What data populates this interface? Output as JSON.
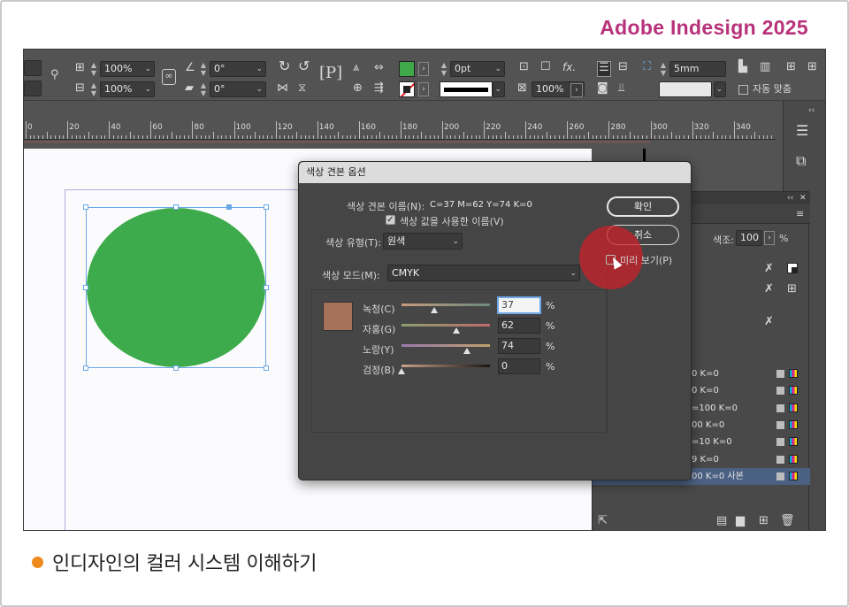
{
  "brand": "Adobe Indesign 2025",
  "caption": "인디자인의 컬러 시스템 이해하기",
  "colors": {
    "brand": "#b8327a",
    "bullet": "#ef8a1e",
    "fill_swatch": "#3fa94a",
    "preview_swatch": "#a7725a",
    "highlight": "#ce1e28"
  },
  "control_bar": {
    "scale_x": "100%",
    "scale_y": "100%",
    "rotate": "0°",
    "shear": "0°",
    "stroke_weight": "0pt",
    "opacity": "100%",
    "gap": "5mm",
    "auto_fit_label": "자동 맞춤",
    "paragraph_glyph": "P",
    "fx_label": "fx."
  },
  "ruler": {
    "ticks": [
      "0",
      "20",
      "40",
      "60",
      "80",
      "100",
      "120",
      "140",
      "160",
      "180",
      "200",
      "220",
      "240",
      "260",
      "280",
      "300",
      "320",
      "340"
    ]
  },
  "swatches_panel": {
    "tint_label": "색조:",
    "tint_value": "100",
    "tint_unit": "%",
    "rows": [
      {
        "label": "0 K=0",
        "selected": false
      },
      {
        "label": "0 K=0",
        "selected": false
      },
      {
        "label": "=100 K=0",
        "selected": false
      },
      {
        "label": "00 K=0",
        "selected": false
      },
      {
        "label": "=10 K=0",
        "selected": false
      },
      {
        "label": "9 K=0",
        "selected": false
      },
      {
        "label": "00 K=0 사본",
        "selected": true
      }
    ]
  },
  "dialog": {
    "title": "색상 견본 옵션",
    "swatch_name_label": "색상 견본 이름(N):",
    "swatch_name_value": "C=37 M=62 Y=74 K=0",
    "name_with_value_label": "색상 값을 사용한 이름(V)",
    "color_type_label": "색상 유형(T):",
    "color_type_value": "원색",
    "color_mode_label": "색상 모드(M):",
    "color_mode_value": "CMYK",
    "ok_label": "확인",
    "cancel_label": "취소",
    "preview_label": "미리 보기(P)",
    "channels": [
      {
        "label": "녹청(C)",
        "value": "37",
        "fraction": 0.37,
        "unit": "%"
      },
      {
        "label": "자홍(G)",
        "value": "62",
        "fraction": 0.62,
        "unit": "%"
      },
      {
        "label": "노랑(Y)",
        "value": "74",
        "fraction": 0.74,
        "unit": "%"
      },
      {
        "label": "검정(B)",
        "value": "0",
        "fraction": 0.0,
        "unit": "%"
      }
    ]
  }
}
